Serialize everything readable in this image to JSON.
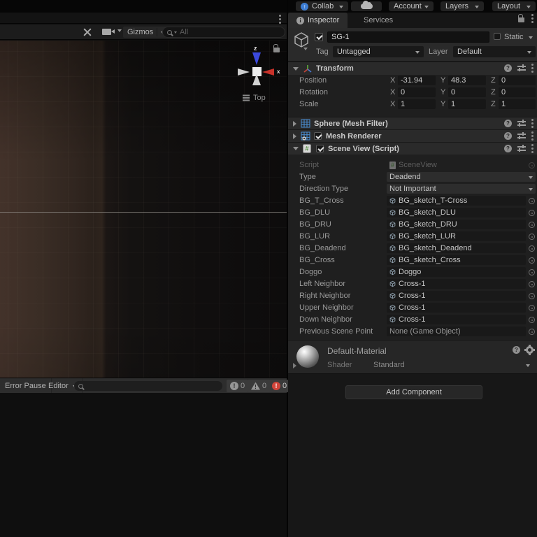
{
  "toolbar": {
    "collab_label": "Collab",
    "account_label": "Account",
    "layers_label": "Layers",
    "layout_label": "Layout"
  },
  "scene_view": {
    "gizmos_label": "Gizmos",
    "search_placeholder": "All",
    "axis_z_label": "z",
    "axis_x_label": "x",
    "view_label": "Top"
  },
  "console": {
    "error_pause_label": "Error Pause",
    "editor_label": "Editor",
    "log_count": "0",
    "warning_count": "0",
    "error_count": "0"
  },
  "inspector": {
    "tabs": [
      "Inspector",
      "Services"
    ],
    "game_object": {
      "name": "SG-1",
      "static_label": "Static",
      "tag_label": "Tag",
      "tag_value": "Untagged",
      "layer_label": "Layer",
      "layer_value": "Default"
    },
    "transform": {
      "title": "Transform",
      "axis_labels": [
        "X",
        "Y",
        "Z"
      ],
      "rows": [
        {
          "label": "Position",
          "x": "-31.94",
          "y": "48.3",
          "z": "0"
        },
        {
          "label": "Rotation",
          "x": "0",
          "y": "0",
          "z": "0"
        },
        {
          "label": "Scale",
          "x": "1",
          "y": "1",
          "z": "1"
        }
      ]
    },
    "components": [
      {
        "title": "Sphere (Mesh Filter)",
        "icon": "mesh-filter",
        "checkbox": false,
        "expanded": false
      },
      {
        "title": "Mesh Renderer",
        "icon": "mesh-renderer",
        "checkbox": true,
        "expanded": false
      },
      {
        "title": "Scene View (Script)",
        "icon": "script",
        "checkbox": true,
        "expanded": true
      }
    ],
    "script_props": [
      {
        "label": "Script",
        "value": "SceneView",
        "type": "script"
      },
      {
        "label": "Type",
        "value": "Deadend",
        "type": "dropdown"
      },
      {
        "label": "Direction Type",
        "value": "Not Important",
        "type": "dropdown"
      },
      {
        "label": "BG_T_Cross",
        "value": "BG_sketch_T-Cross",
        "type": "object"
      },
      {
        "label": "BG_DLU",
        "value": "BG_sketch_DLU",
        "type": "object"
      },
      {
        "label": "BG_DRU",
        "value": "BG_sketch_DRU",
        "type": "object"
      },
      {
        "label": "BG_LUR",
        "value": "BG_sketch_LUR",
        "type": "object"
      },
      {
        "label": "BG_Deadend",
        "value": "BG_sketch_Deadend",
        "type": "object"
      },
      {
        "label": "BG_Cross",
        "value": "BG_sketch_Cross",
        "type": "object"
      },
      {
        "label": "Doggo",
        "value": "Doggo",
        "type": "object"
      },
      {
        "label": "Left Neighbor",
        "value": "Cross-1",
        "type": "object"
      },
      {
        "label": "Right Neighbor",
        "value": "Cross-1",
        "type": "object"
      },
      {
        "label": "Upper Neighbor",
        "value": "Cross-1",
        "type": "object"
      },
      {
        "label": "Down Neighbor",
        "value": "Cross-1",
        "type": "object"
      },
      {
        "label": "Previous Scene Point",
        "value": "None (Game Object)",
        "type": "none"
      }
    ],
    "material": {
      "name": "Default-Material",
      "shader_label": "Shader",
      "shader_value": "Standard"
    },
    "add_component_label": "Add Component"
  },
  "colors": {
    "collab_blue": "#3d7dd2",
    "axis_x_red": "#c8322a",
    "axis_z_blue": "#3b49dc",
    "error_red": "#d0443a",
    "mesh_icon_blue": "#4a8fd4",
    "script_icon_green": "#4e8f3c"
  }
}
